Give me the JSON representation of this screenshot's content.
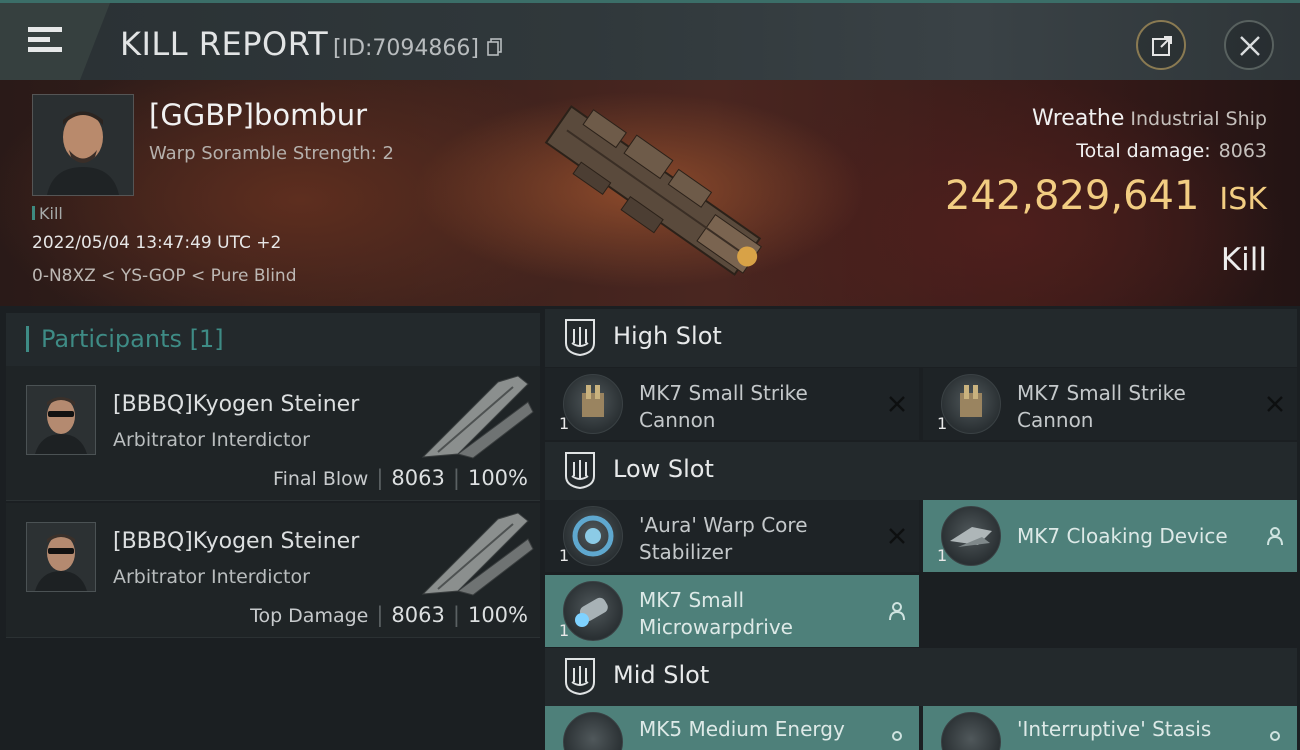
{
  "header": {
    "title": "KILL REPORT",
    "report_id": "[ID:7094866]"
  },
  "victim": {
    "name": "[GGBP]bombur",
    "warp_scramble": "Warp Soramble Strength: 2",
    "kill_tag": "Kill",
    "datetime": "2022/05/04 13:47:49 UTC +2",
    "location": "0-N8XZ < YS-GOP < Pure Blind",
    "ship_name": "Wreathe",
    "ship_class": "Industrial Ship",
    "total_damage_label": "Total damage:",
    "total_damage": "8063",
    "isk_value": "242,829,641",
    "isk_unit": "ISK",
    "result": "Kill"
  },
  "participants": {
    "title": "Participants [1]",
    "rows": [
      {
        "name": "[BBBQ]Kyogen Steiner",
        "ship": "Arbitrator Interdictor",
        "role": "Final Blow",
        "damage": "8063",
        "percent": "100%"
      },
      {
        "name": "[BBBQ]Kyogen Steiner",
        "ship": "Arbitrator Interdictor",
        "role": "Top Damage",
        "damage": "8063",
        "percent": "100%"
      }
    ]
  },
  "fitting": {
    "high_slot": {
      "title": "High Slot",
      "modules": [
        {
          "name": "MK7 Small Strike Cannon",
          "qty": "1",
          "state": "destroyed"
        },
        {
          "name": "MK7 Small Strike Cannon",
          "qty": "1",
          "state": "destroyed"
        }
      ]
    },
    "low_slot": {
      "title": "Low Slot",
      "modules": [
        {
          "name": "'Aura' Warp Core Stabilizer",
          "qty": "1",
          "state": "destroyed"
        },
        {
          "name": "MK7 Cloaking Device",
          "qty": "1",
          "state": "dropped"
        },
        {
          "name": "MK7 Small Microwarpdrive",
          "qty": "1",
          "state": "dropped"
        }
      ]
    },
    "mid_slot": {
      "title": "Mid Slot",
      "modules": [
        {
          "name": "MK5 Medium Energy",
          "qty": "",
          "state": "dropped"
        },
        {
          "name": "'Interruptive' Stasis",
          "qty": "",
          "state": "dropped"
        }
      ]
    }
  },
  "icons": {
    "menu": "hamburger-icon",
    "copy": "copy-icon",
    "share": "share-icon",
    "close": "close-icon",
    "destroyed": "x-icon",
    "dropped": "person-icon",
    "slot": "slot-icon"
  },
  "colors": {
    "accent_teal": "#3e8b85",
    "dropped_bg": "#4e807a",
    "isk_gold": "#f2cd82"
  }
}
